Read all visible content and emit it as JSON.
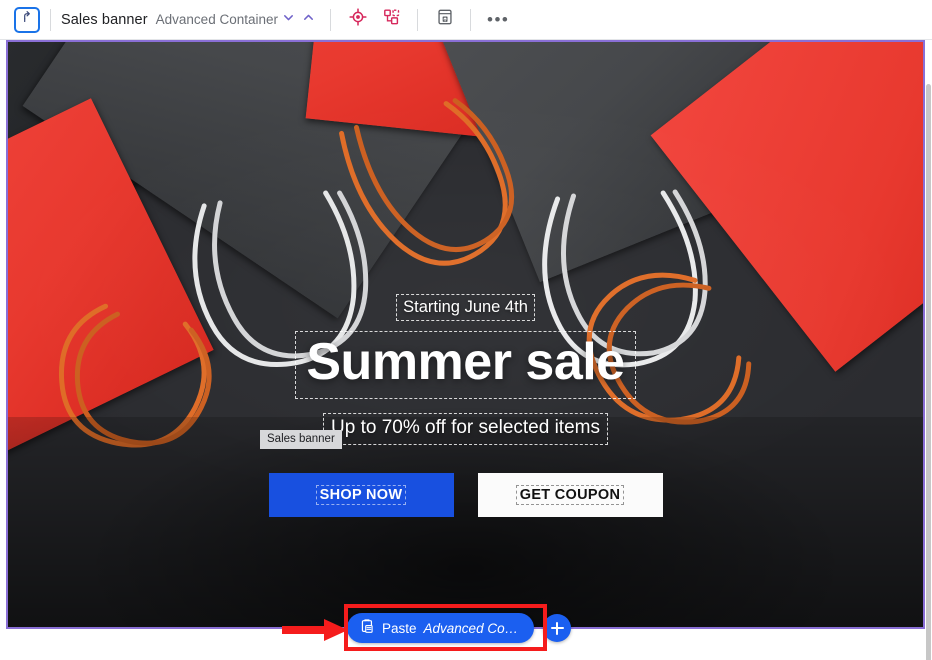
{
  "toolbar": {
    "up_icon": "arrow-up-parent-icon",
    "title": "Sales banner",
    "subtitle": "Advanced Container",
    "chevron_down": "chevron-down-icon",
    "chevron_up": "chevron-up-icon",
    "target_icon": "target-crosshair-icon",
    "structure_icon": "component-structure-icon",
    "save_icon": "save-to-library-icon",
    "more_label": "•••"
  },
  "banner": {
    "eyebrow": "Starting June 4th",
    "headline": "Summer sale",
    "subline": "Up to 70% off for selected items",
    "cta_primary": "SHOP NOW",
    "cta_secondary": "GET COUPON",
    "selected_name_badge": "Sales banner"
  },
  "bottom_bar": {
    "paste_icon": "paste-clipboard-icon",
    "paste_label": "Paste",
    "paste_target": "Advanced Co…",
    "add_label": "+",
    "add_icon": "plus-icon"
  },
  "colors": {
    "accent_blue": "#1b5ff0",
    "cta_blue": "#1850e0",
    "selection_purple": "#8a6fd6",
    "annotation_red": "#f51c1c",
    "toolbar_icon_red": "#d6285c",
    "badge_gray": "#d7d8da",
    "canvas_dark": "#2b2c30",
    "bag_red": "#e8392f"
  }
}
